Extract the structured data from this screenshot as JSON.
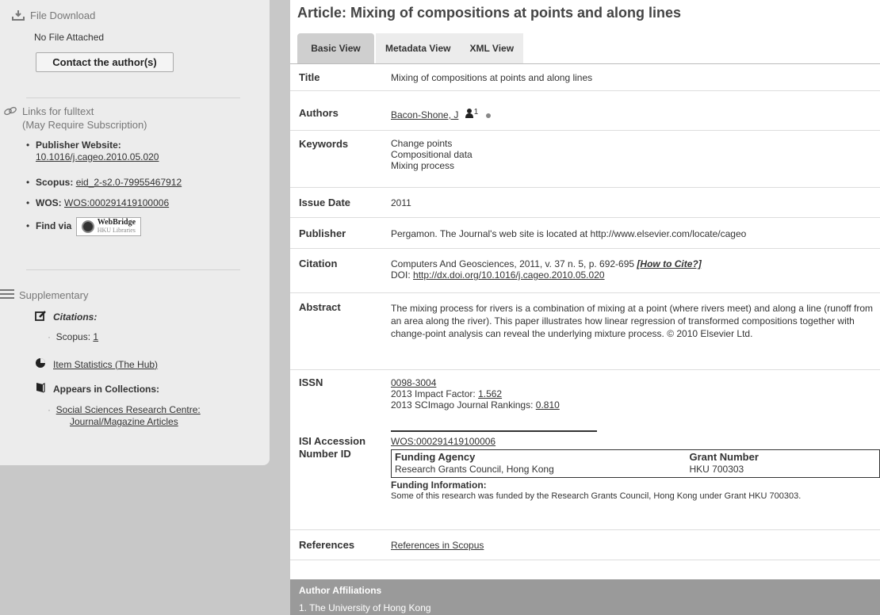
{
  "sidebar": {
    "file_download": {
      "title": "File Download",
      "no_file": "No File Attached",
      "contact_button": "Contact the author(s)"
    },
    "links": {
      "title_line1": "Links for fulltext",
      "title_line2": "(May Require Subscription)",
      "items": [
        {
          "label": "Publisher Website:",
          "value": "10.1016/j.cageo.2010.05.020"
        },
        {
          "label": "Scopus:",
          "value": "eid_2-s2.0-79955467912"
        },
        {
          "label": "WOS:",
          "value": "WOS:000291419100006"
        },
        {
          "label": "Find via",
          "value": ""
        }
      ],
      "webbridge_title": "WebBridge",
      "webbridge_sub": "HKU Libraries"
    },
    "supplementary": {
      "title": "Supplementary",
      "citations_label": "Citations:",
      "scopus_prefix": "Scopus:",
      "scopus_count": "1",
      "item_statistics": "Item Statistics (The Hub)",
      "appears_in": "Appears in Collections:",
      "collection_line1": "Social Sciences Research Centre:",
      "collection_line2": "Journal/Magazine Articles"
    }
  },
  "main": {
    "title": "Article: Mixing of compositions at points and along lines",
    "tabs": [
      {
        "label": "Basic View"
      },
      {
        "label": "Metadata View"
      },
      {
        "label": "XML View"
      }
    ],
    "fields": {
      "title": {
        "label": "Title",
        "value": "Mixing of compositions at points and along lines"
      },
      "authors": {
        "label": "Authors",
        "name": "Bacon-Shone, J",
        "sup": "1"
      },
      "keywords": {
        "label": "Keywords",
        "values": [
          "Change points",
          "Compositional data",
          "Mixing process"
        ]
      },
      "issue_date": {
        "label": "Issue Date",
        "value": "2011"
      },
      "publisher": {
        "label": "Publisher",
        "value": "Pergamon. The Journal's web site is located at http://www.elsevier.com/locate/cageo"
      },
      "citation": {
        "label": "Citation",
        "text": "Computers And Geosciences, 2011, v. 37 n. 5, p. 692-695 ",
        "how_to_cite": "[How to Cite?]",
        "doi_prefix": "DOI: ",
        "doi": "http://dx.doi.org/10.1016/j.cageo.2010.05.020"
      },
      "abstract": {
        "label": "Abstract",
        "value": "The mixing process for rivers is a combination of mixing at a point (where rivers meet) and along a line (runoff from an area along the river). This paper illustrates how linear regression of transformed compositions together with change-point analysis can reveal the underlying mixture process. © 2010 Elsevier Ltd."
      },
      "issn": {
        "label": "ISSN",
        "value": "0098-3004",
        "impact_prefix": "2013 Impact Factor: ",
        "impact": "1.562",
        "sjr_prefix": "2013 SCImago Journal Rankings: ",
        "sjr": "0.810"
      },
      "isi": {
        "label_line1": "ISI Accession",
        "label_line2": "Number ID",
        "value": "WOS:000291419100006",
        "funding_agency_header": "Funding Agency",
        "grant_number_header": "Grant Number",
        "agency": "Research Grants Council, Hong Kong",
        "grant": "HKU 700303",
        "funding_info_label": "Funding Information:",
        "funding_info": "Some of this research was funded by the Research Grants Council, Hong Kong under Grant HKU 700303."
      },
      "references": {
        "label": "References",
        "value": "References in Scopus"
      }
    },
    "affiliations": {
      "title": "Author Affiliations",
      "items": [
        "1.  The University of Hong Kong"
      ]
    }
  }
}
